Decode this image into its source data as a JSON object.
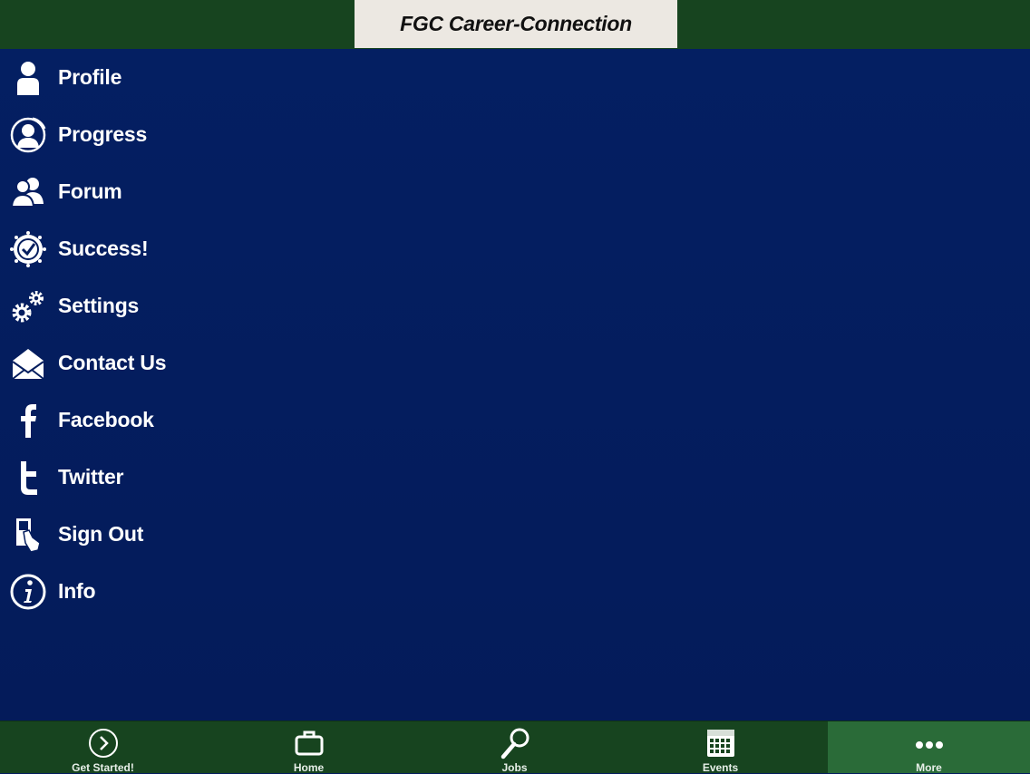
{
  "header": {
    "title": "FGC Career-Connection"
  },
  "menu": {
    "items": [
      {
        "label": "Profile",
        "icon": "person-icon"
      },
      {
        "label": "Progress",
        "icon": "progress-icon"
      },
      {
        "label": "Forum",
        "icon": "forum-icon"
      },
      {
        "label": "Success!",
        "icon": "success-badge-icon"
      },
      {
        "label": "Settings",
        "icon": "gears-icon"
      },
      {
        "label": "Contact Us",
        "icon": "envelope-icon"
      },
      {
        "label": "Facebook",
        "icon": "facebook-icon"
      },
      {
        "label": "Twitter",
        "icon": "twitter-icon"
      },
      {
        "label": "Sign Out",
        "icon": "sign-out-icon"
      },
      {
        "label": "Info",
        "icon": "info-icon"
      }
    ]
  },
  "tabbar": {
    "tabs": [
      {
        "label": "Get Started!",
        "icon": "chevron-circle-icon",
        "active": false
      },
      {
        "label": "Home",
        "icon": "briefcase-icon",
        "active": false
      },
      {
        "label": "Jobs",
        "icon": "magnifier-icon",
        "active": false
      },
      {
        "label": "Events",
        "icon": "calendar-icon",
        "active": false
      },
      {
        "label": "More",
        "icon": "more-dots-icon",
        "active": true
      }
    ]
  },
  "colors": {
    "header_bg": "#17441f",
    "title_box_bg": "#ece8e2",
    "menu_bg": "#041d5e",
    "tabbar_bg": "#17441f",
    "active_tab_bg": "#2a6b38"
  }
}
